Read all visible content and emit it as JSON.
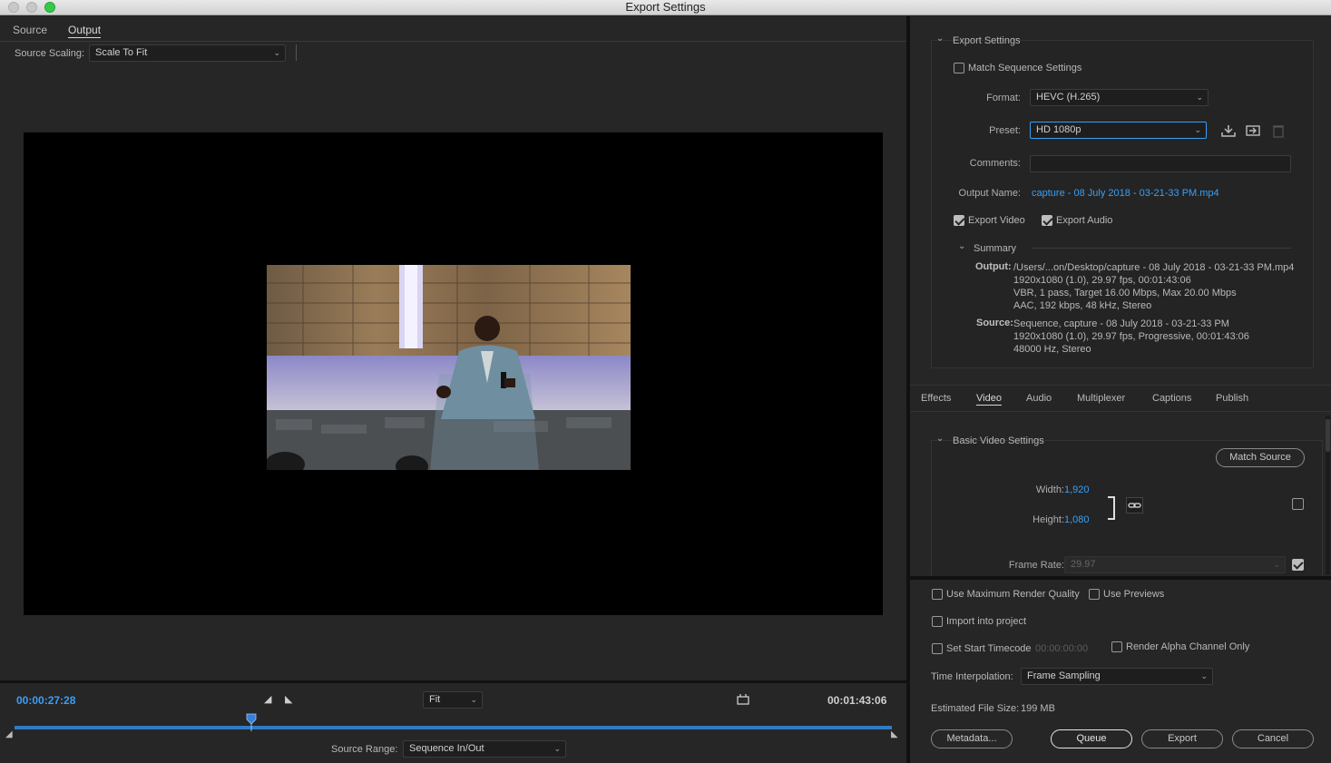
{
  "window": {
    "title": "Export Settings"
  },
  "left": {
    "tabs": [
      {
        "label": "Source"
      },
      {
        "label": "Output"
      }
    ],
    "source_scaling_label": "Source Scaling:",
    "source_scaling_value": "Scale To Fit",
    "timecode_current": "00:00:27:28",
    "timecode_end": "00:01:43:06",
    "zoom_value": "Fit",
    "source_range_label": "Source Range:",
    "source_range_value": "Sequence In/Out",
    "playhead_fraction": 0.27
  },
  "export_settings": {
    "header": "Export Settings",
    "match_sequence_label": "Match Sequence Settings",
    "format_label": "Format:",
    "format_value": "HEVC (H.265)",
    "preset_label": "Preset:",
    "preset_value": "HD 1080p",
    "comments_label": "Comments:",
    "comments_value": "",
    "output_name_label": "Output Name:",
    "output_name_value": "capture - 08 July 2018 - 03-21-33 PM.mp4",
    "export_video_label": "Export Video",
    "export_audio_label": "Export Audio",
    "summary_header": "Summary",
    "output_label": "Output:",
    "output_lines": [
      "/Users/...on/Desktop/capture - 08 July 2018 - 03-21-33 PM.mp4",
      "1920x1080 (1.0), 29.97 fps, 00:01:43:06",
      "VBR, 1 pass, Target 16.00 Mbps, Max 20.00 Mbps",
      "AAC, 192 kbps, 48 kHz, Stereo"
    ],
    "source_label": "Source:",
    "source_lines": [
      "Sequence, capture - 08 July 2018 - 03-21-33 PM",
      "1920x1080 (1.0), 29.97 fps, Progressive, 00:01:43:06",
      "48000 Hz, Stereo"
    ]
  },
  "panel_tabs": [
    {
      "label": "Effects"
    },
    {
      "label": "Video"
    },
    {
      "label": "Audio"
    },
    {
      "label": "Multiplexer"
    },
    {
      "label": "Captions"
    },
    {
      "label": "Publish"
    }
  ],
  "video": {
    "header": "Basic Video Settings",
    "match_source_label": "Match Source",
    "width_label": "Width:",
    "width_value": "1,920",
    "height_label": "Height:",
    "height_value": "1,080",
    "frame_rate_label": "Frame Rate:",
    "frame_rate_value": "29.97"
  },
  "bottom": {
    "max_render_label": "Use Maximum Render Quality",
    "use_previews_label": "Use Previews",
    "import_label": "Import into project",
    "start_tc_label": "Set Start Timecode",
    "start_tc_value": "00:00:00:00",
    "alpha_label": "Render Alpha Channel Only",
    "time_interp_label": "Time Interpolation:",
    "time_interp_value": "Frame Sampling",
    "file_size_label": "Estimated File Size:",
    "file_size_value": "199 MB",
    "metadata_label": "Metadata...",
    "queue_label": "Queue",
    "export_label": "Export",
    "cancel_label": "Cancel"
  },
  "colors": {
    "accent": "#3a9ff5",
    "background": "#262626",
    "playhead": "#3a7fd5"
  },
  "icons": [
    "chevron-down-icon",
    "save-preset-icon",
    "import-preset-icon",
    "delete-preset-icon",
    "link-icon",
    "mark-in-icon",
    "mark-out-icon",
    "crop-icon"
  ]
}
